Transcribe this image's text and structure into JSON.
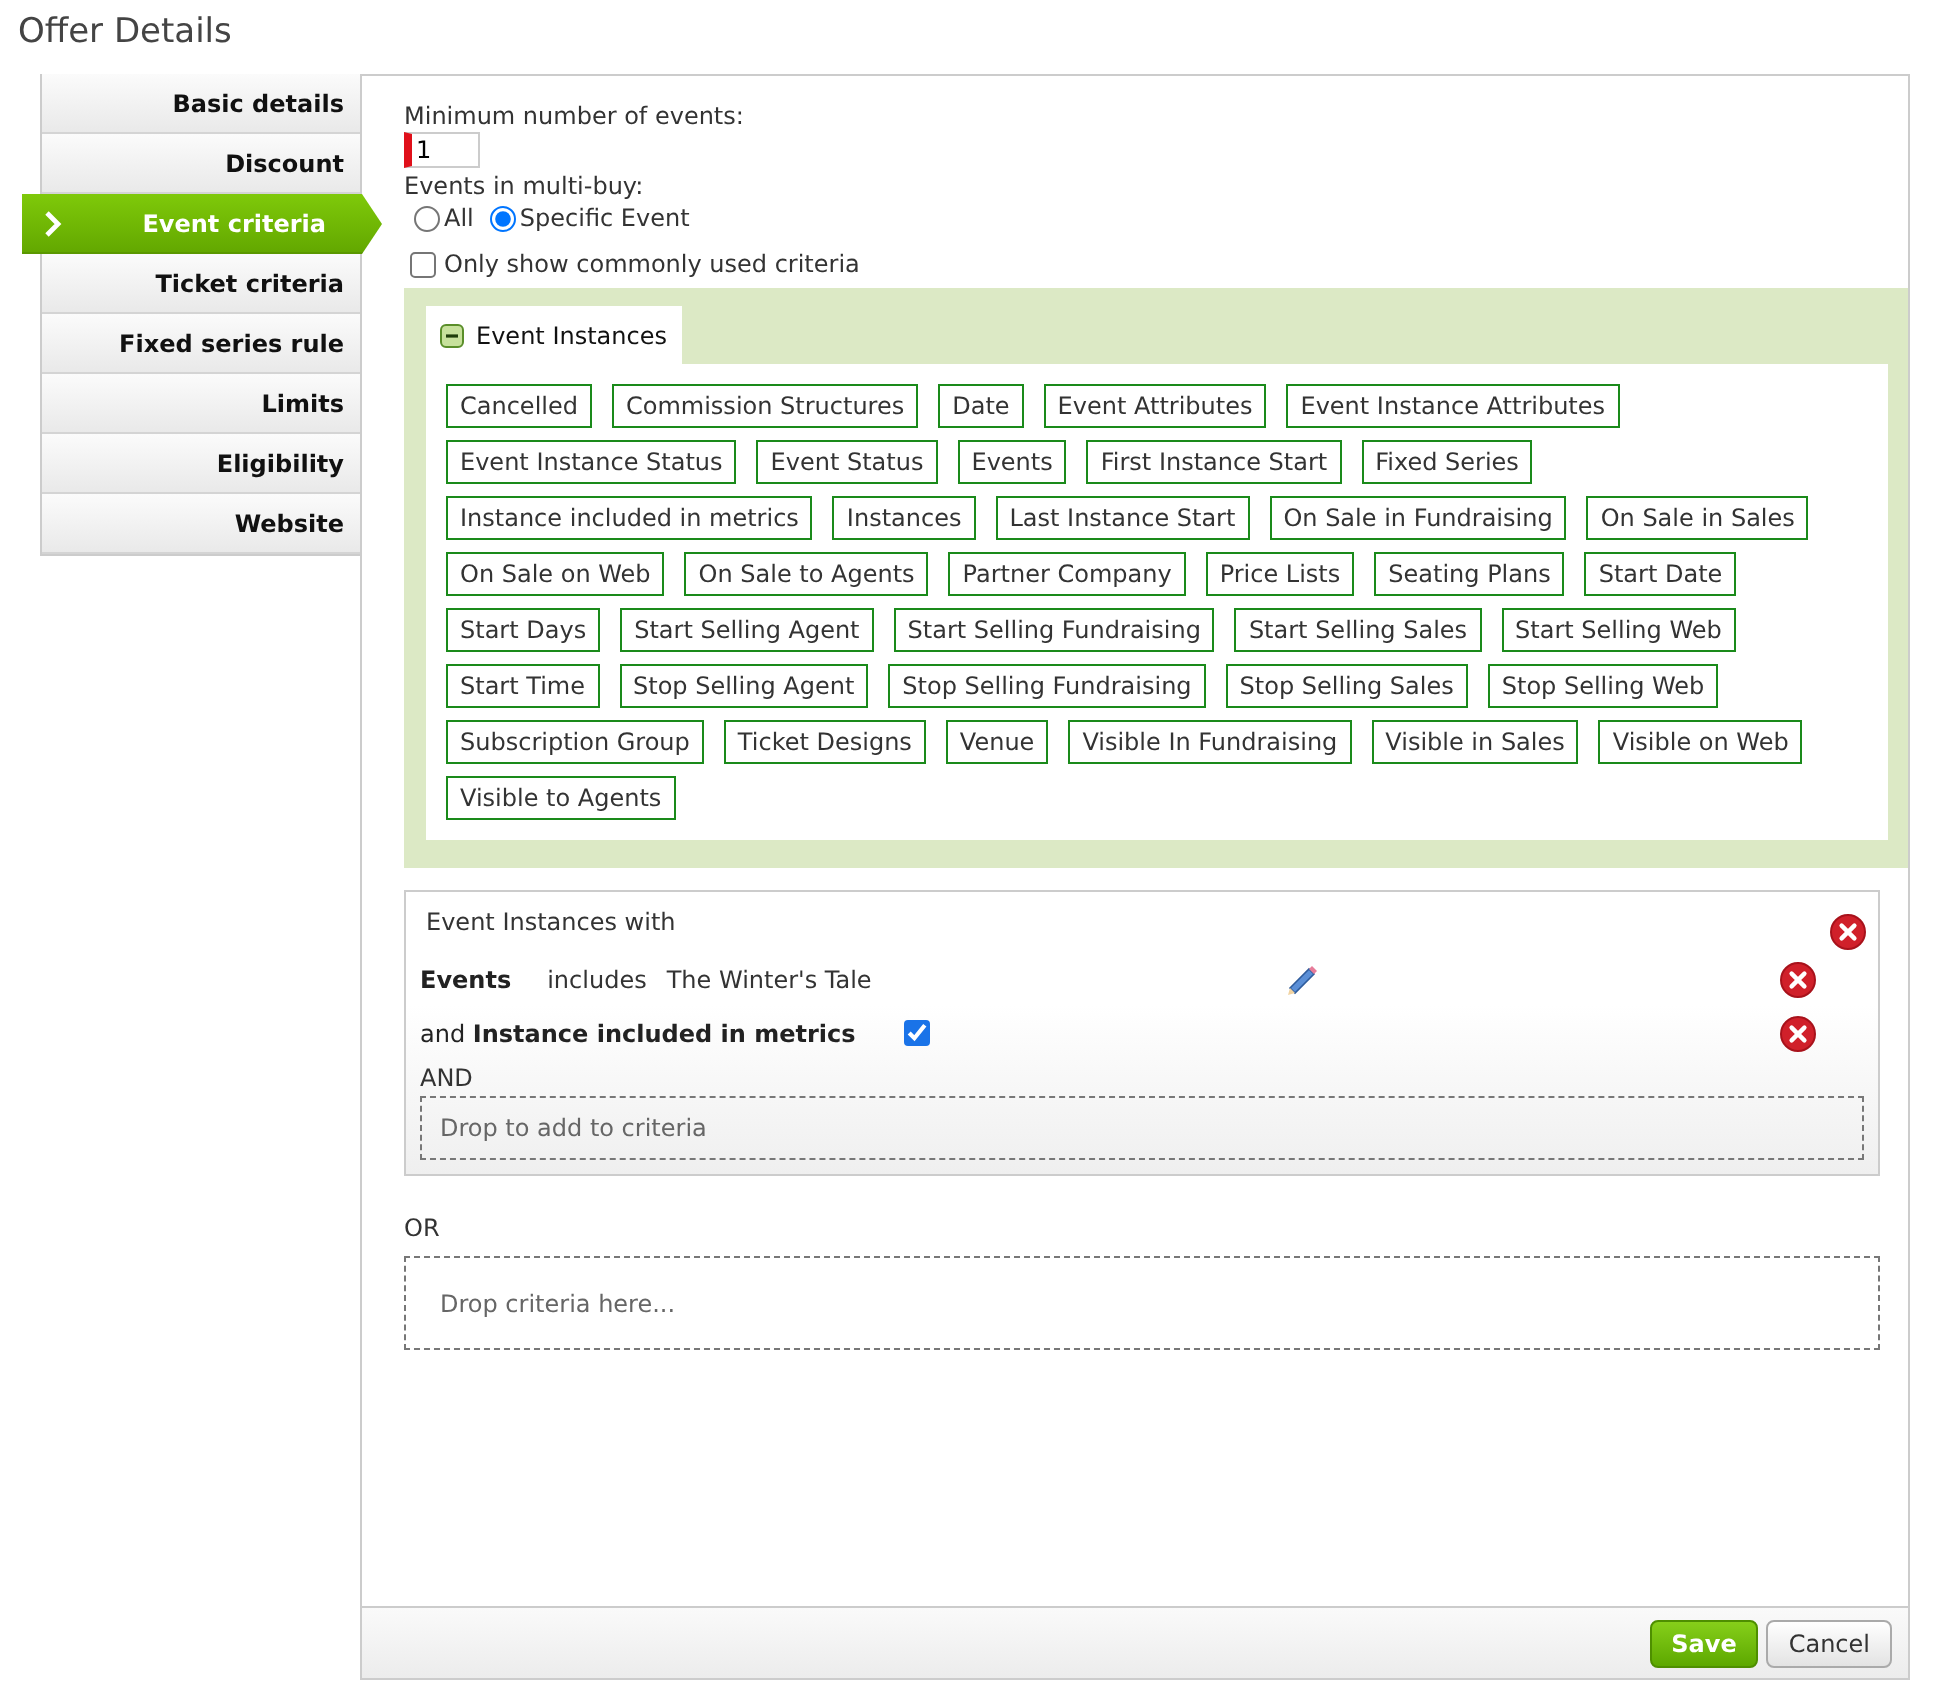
{
  "page_title": "Offer Details",
  "sidebar": {
    "items": [
      {
        "label": "Basic details",
        "selected": false
      },
      {
        "label": "Discount",
        "selected": false
      },
      {
        "label": "Event criteria",
        "selected": true
      },
      {
        "label": "Ticket criteria",
        "selected": false
      },
      {
        "label": "Fixed series rule",
        "selected": false
      },
      {
        "label": "Limits",
        "selected": false
      },
      {
        "label": "Eligibility",
        "selected": false
      },
      {
        "label": "Website",
        "selected": false
      }
    ]
  },
  "min_events": {
    "label": "Minimum number of events:",
    "value": "1",
    "invalid": true
  },
  "multi_buy": {
    "label": "Events in multi-buy:",
    "options": [
      {
        "label": "All",
        "selected": false
      },
      {
        "label": "Specific Event",
        "selected": true
      }
    ]
  },
  "common_only": {
    "label": "Only show commonly used criteria",
    "checked": false
  },
  "criteria_group": {
    "tab": {
      "label": "Event Instances",
      "expanded": true
    },
    "chips": [
      "Cancelled",
      "Commission Structures",
      "Date",
      "Event Attributes",
      "Event Instance Attributes",
      "Event Instance Status",
      "Event Status",
      "Events",
      "First Instance Start",
      "Fixed Series",
      "Instance included in metrics",
      "Instances",
      "Last Instance Start",
      "On Sale in Fundraising",
      "On Sale in Sales",
      "On Sale on Web",
      "On Sale to Agents",
      "Partner Company",
      "Price Lists",
      "Seating Plans",
      "Start Date",
      "Start Days",
      "Start Selling Agent",
      "Start Selling Fundraising",
      "Start Selling Sales",
      "Start Selling Web",
      "Start Time",
      "Stop Selling Agent",
      "Stop Selling Fundraising",
      "Stop Selling Sales",
      "Stop Selling Web",
      "Subscription Group",
      "Ticket Designs",
      "Venue",
      "Visible In Fundraising",
      "Visible in Sales",
      "Visible on Web",
      "Visible to Agents"
    ]
  },
  "rule": {
    "title": "Event Instances with",
    "conditions": [
      {
        "kind": "includes",
        "field": "Events",
        "operator": "includes",
        "value": "The Winter's Tale"
      },
      {
        "kind": "flag",
        "text": "and **Instance included in metrics**",
        "checked": true
      }
    ],
    "joiner": "AND",
    "drop_hint": "Drop to add to criteria"
  },
  "or_label": "OR",
  "drop_zone": "Drop criteria here...",
  "buttons": [
    {
      "label": "Save",
      "kind": "primary"
    },
    {
      "label": "Cancel",
      "kind": "secondary"
    }
  ]
}
